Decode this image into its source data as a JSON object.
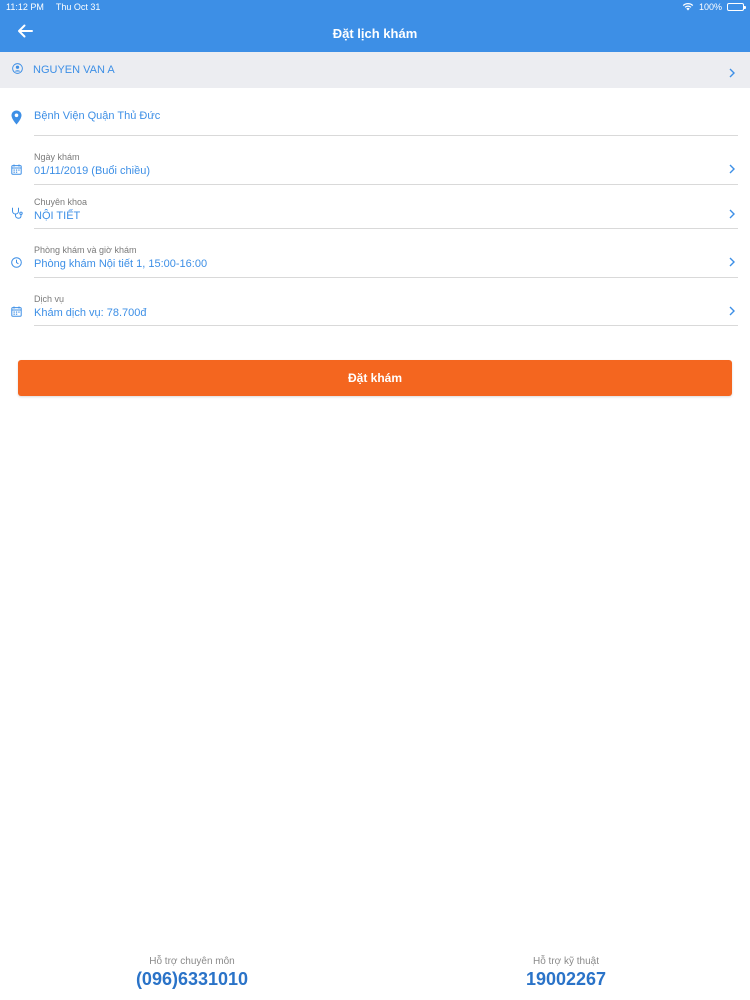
{
  "status_bar": {
    "time": "11:12 PM",
    "date": "Thu Oct 31",
    "battery": "100%"
  },
  "header": {
    "title": "Đặt lịch khám",
    "back_icon": "arrow-left-icon"
  },
  "patient": {
    "name": "NGUYEN VAN A",
    "icon": "user-icon"
  },
  "hospital": {
    "name": "Bệnh Viện Quận Thủ Đức",
    "icon": "location-pin-icon"
  },
  "form": {
    "date": {
      "label": "Ngày khám",
      "value": "01/11/2019 (Buổi chiều)",
      "icon": "calendar-icon"
    },
    "specialty": {
      "label": "Chuyên khoa",
      "value": "NỘI TIẾT",
      "icon": "stethoscope-icon"
    },
    "clinic_time": {
      "label": "Phòng khám và giờ khám",
      "value": "Phòng khám Nội tiết 1, 15:00-16:00",
      "icon": "clock-icon"
    },
    "service": {
      "label": "Dịch vụ",
      "value": "Khám dịch vụ: 78.700đ",
      "icon": "calendar-icon"
    }
  },
  "submit_label": "Đặt khám",
  "support": {
    "professional_label": "Hỗ trợ chuyên môn",
    "professional_phone": "(096)6331010",
    "technical_label": "Hỗ trợ kỹ thuật",
    "technical_phone": "19002267"
  },
  "colors": {
    "primary": "#3d8fe6",
    "accent": "#f4661f",
    "phone": "#2a73c8"
  }
}
